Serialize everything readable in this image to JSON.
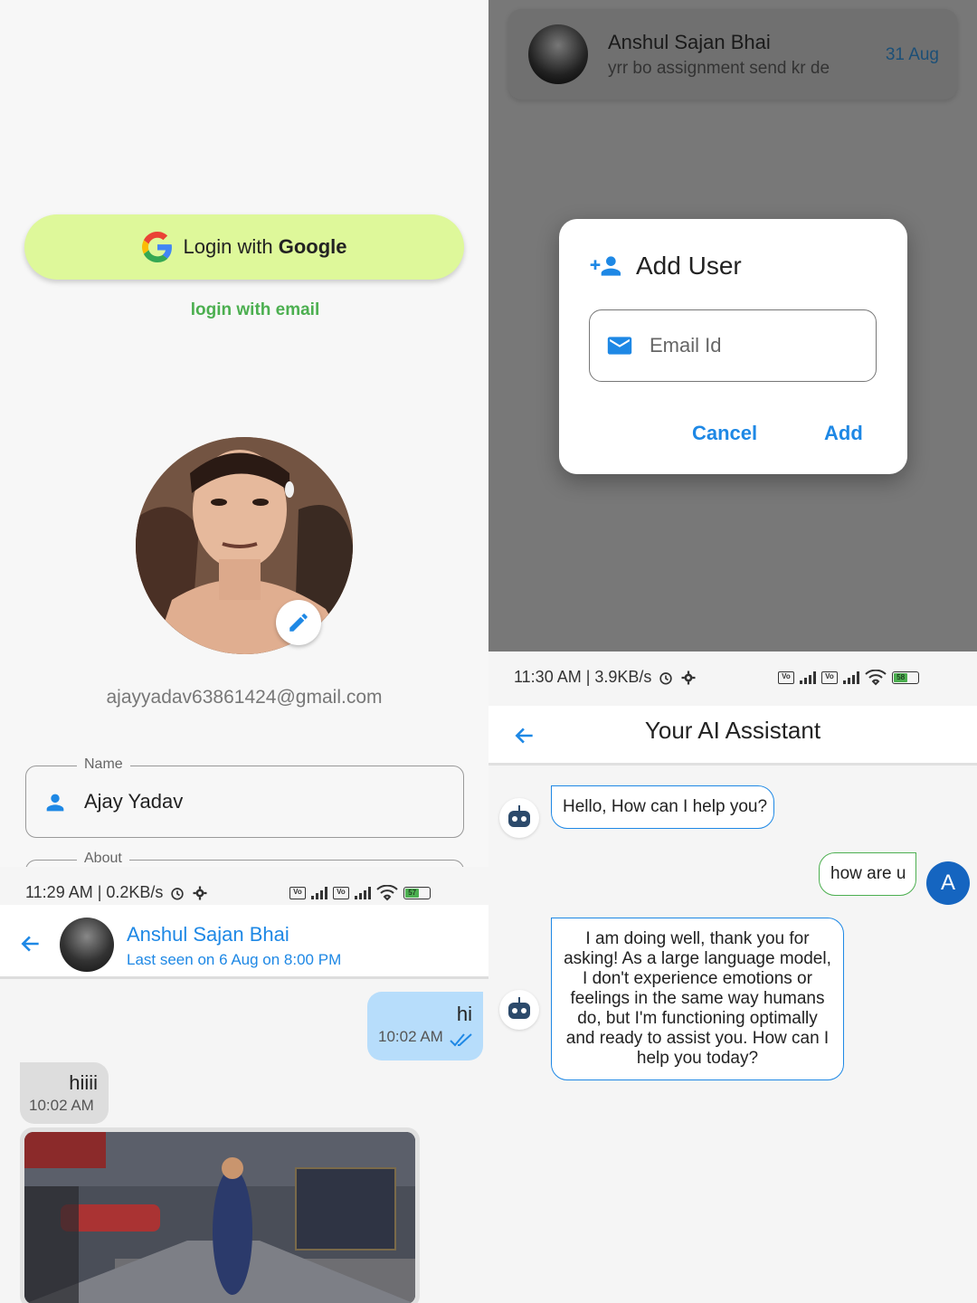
{
  "login": {
    "google_prefix": "Login with",
    "google_brand": "Google",
    "email_link": "login with email",
    "profile_email": "ajayyadav63861424@gmail.com",
    "name_label": "Name",
    "name_value": "Ajay Yadav",
    "about_label": "About"
  },
  "dialog_screen": {
    "chat_item": {
      "name": "Anshul Sajan Bhai",
      "last_message": "yrr bo assignment send kr de",
      "date": "31 Aug"
    },
    "dialog": {
      "title": "Add User",
      "email_placeholder": "Email Id",
      "cancel": "Cancel",
      "add": "Add"
    }
  },
  "chat_screen": {
    "status": {
      "time": "11:29 AM | 0.2KB/s",
      "battery": "57"
    },
    "contact_name": "Anshul Sajan Bhai",
    "last_seen": "Last seen on 6 Aug on 8:00 PM",
    "messages": [
      {
        "text": "hi",
        "time": "10:02 AM",
        "direction": "out",
        "read": true
      },
      {
        "text": "hiiii",
        "time": "10:02 AM",
        "direction": "in"
      }
    ]
  },
  "ai_screen": {
    "status": {
      "time": "11:30 AM | 3.9KB/s",
      "battery": "58"
    },
    "title": "Your AI Assistant",
    "messages": [
      {
        "text": "Hello, How can I help you?",
        "from": "bot"
      },
      {
        "text": "how are u",
        "from": "user"
      },
      {
        "text": "I am doing well, thank you for asking!  As a large language model, I don't experience emotions or feelings in the same way humans do, but I'm functioning optimally and ready to assist you. How can I help you today?",
        "from": "bot"
      }
    ],
    "user_initial": "A"
  },
  "colors": {
    "accent_blue": "#1e88e5",
    "google_button": "#def89a",
    "email_link_green": "#4caf50",
    "outgoing_bubble": "#b7ddfb",
    "incoming_bubble": "#dddddd",
    "overlay_gray": "#787878"
  }
}
